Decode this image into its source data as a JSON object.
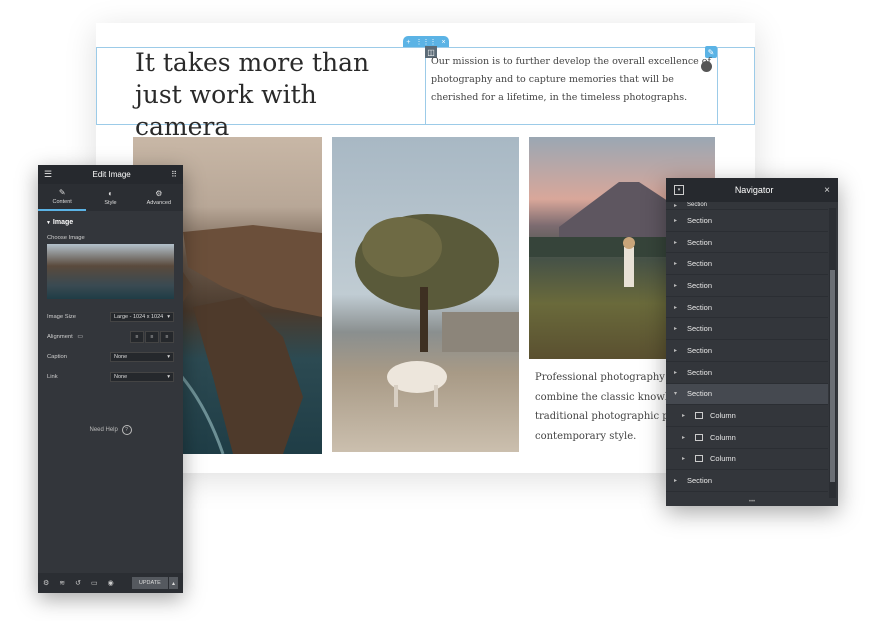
{
  "canvas": {
    "heading": "It takes more than just work with camera",
    "mission": "Our mission is to further develop the overall excellence of photography and to capture memories that will be cherished for a lifetime, in the timeless photographs.",
    "photo_text": "Professional photography servi combine the classic knowledge traditional photographic portr contemporary style.",
    "handle_plus": "+",
    "handle_move": "⋮⋮⋮",
    "handle_close": "×"
  },
  "edit_panel": {
    "title": "Edit Image",
    "tabs": [
      {
        "label": "Content",
        "icon": "pencil-icon"
      },
      {
        "label": "Style",
        "icon": "half-circle-icon"
      },
      {
        "label": "Advanced",
        "icon": "gear-icon"
      }
    ],
    "section": "Image",
    "choose_image": "Choose Image",
    "image_size_label": "Image Size",
    "image_size_value": "Large - 1024 x 1024",
    "alignment_label": "Alignment",
    "caption_label": "Caption",
    "caption_value": "None",
    "link_label": "Link",
    "link_value": "None",
    "need_help": "Need Help",
    "update": "UPDATE"
  },
  "navigator": {
    "title": "Navigator",
    "items": [
      {
        "label": "Section"
      },
      {
        "label": "Section"
      },
      {
        "label": "Section"
      },
      {
        "label": "Section"
      },
      {
        "label": "Section"
      },
      {
        "label": "Section"
      },
      {
        "label": "Section"
      },
      {
        "label": "Section"
      },
      {
        "label": "Section"
      },
      {
        "label": "Section"
      },
      {
        "label": "Column"
      },
      {
        "label": "Column"
      },
      {
        "label": "Column"
      },
      {
        "label": "Section"
      }
    ]
  },
  "colors": {
    "accent": "#5bb3e5",
    "panel_bg": "#33363b"
  }
}
